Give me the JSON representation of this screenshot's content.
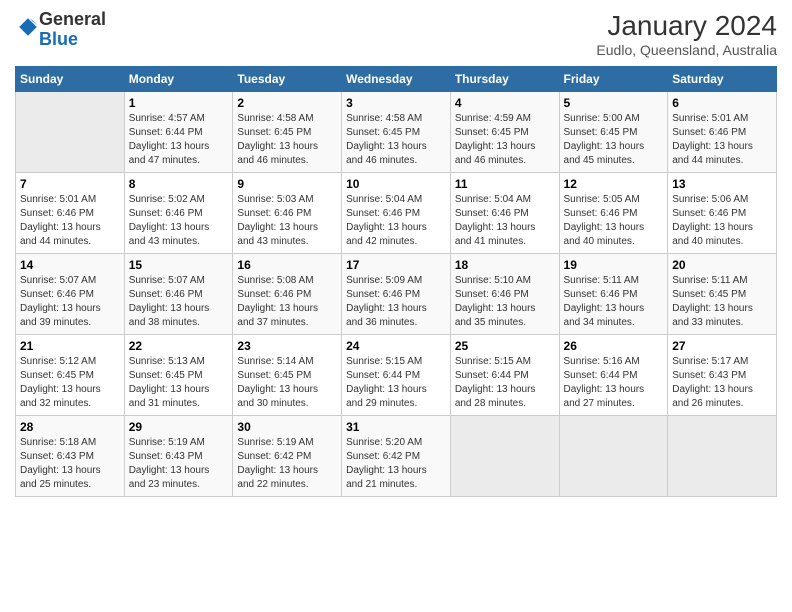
{
  "logo": {
    "general": "General",
    "blue": "Blue"
  },
  "title": "January 2024",
  "subtitle": "Eudlo, Queensland, Australia",
  "headers": [
    "Sunday",
    "Monday",
    "Tuesday",
    "Wednesday",
    "Thursday",
    "Friday",
    "Saturday"
  ],
  "weeks": [
    [
      {
        "day": "",
        "info": ""
      },
      {
        "day": "1",
        "info": "Sunrise: 4:57 AM\nSunset: 6:44 PM\nDaylight: 13 hours\nand 47 minutes."
      },
      {
        "day": "2",
        "info": "Sunrise: 4:58 AM\nSunset: 6:45 PM\nDaylight: 13 hours\nand 46 minutes."
      },
      {
        "day": "3",
        "info": "Sunrise: 4:58 AM\nSunset: 6:45 PM\nDaylight: 13 hours\nand 46 minutes."
      },
      {
        "day": "4",
        "info": "Sunrise: 4:59 AM\nSunset: 6:45 PM\nDaylight: 13 hours\nand 46 minutes."
      },
      {
        "day": "5",
        "info": "Sunrise: 5:00 AM\nSunset: 6:45 PM\nDaylight: 13 hours\nand 45 minutes."
      },
      {
        "day": "6",
        "info": "Sunrise: 5:01 AM\nSunset: 6:46 PM\nDaylight: 13 hours\nand 44 minutes."
      }
    ],
    [
      {
        "day": "7",
        "info": "Sunrise: 5:01 AM\nSunset: 6:46 PM\nDaylight: 13 hours\nand 44 minutes."
      },
      {
        "day": "8",
        "info": "Sunrise: 5:02 AM\nSunset: 6:46 PM\nDaylight: 13 hours\nand 43 minutes."
      },
      {
        "day": "9",
        "info": "Sunrise: 5:03 AM\nSunset: 6:46 PM\nDaylight: 13 hours\nand 43 minutes."
      },
      {
        "day": "10",
        "info": "Sunrise: 5:04 AM\nSunset: 6:46 PM\nDaylight: 13 hours\nand 42 minutes."
      },
      {
        "day": "11",
        "info": "Sunrise: 5:04 AM\nSunset: 6:46 PM\nDaylight: 13 hours\nand 41 minutes."
      },
      {
        "day": "12",
        "info": "Sunrise: 5:05 AM\nSunset: 6:46 PM\nDaylight: 13 hours\nand 40 minutes."
      },
      {
        "day": "13",
        "info": "Sunrise: 5:06 AM\nSunset: 6:46 PM\nDaylight: 13 hours\nand 40 minutes."
      }
    ],
    [
      {
        "day": "14",
        "info": "Sunrise: 5:07 AM\nSunset: 6:46 PM\nDaylight: 13 hours\nand 39 minutes."
      },
      {
        "day": "15",
        "info": "Sunrise: 5:07 AM\nSunset: 6:46 PM\nDaylight: 13 hours\nand 38 minutes."
      },
      {
        "day": "16",
        "info": "Sunrise: 5:08 AM\nSunset: 6:46 PM\nDaylight: 13 hours\nand 37 minutes."
      },
      {
        "day": "17",
        "info": "Sunrise: 5:09 AM\nSunset: 6:46 PM\nDaylight: 13 hours\nand 36 minutes."
      },
      {
        "day": "18",
        "info": "Sunrise: 5:10 AM\nSunset: 6:46 PM\nDaylight: 13 hours\nand 35 minutes."
      },
      {
        "day": "19",
        "info": "Sunrise: 5:11 AM\nSunset: 6:46 PM\nDaylight: 13 hours\nand 34 minutes."
      },
      {
        "day": "20",
        "info": "Sunrise: 5:11 AM\nSunset: 6:45 PM\nDaylight: 13 hours\nand 33 minutes."
      }
    ],
    [
      {
        "day": "21",
        "info": "Sunrise: 5:12 AM\nSunset: 6:45 PM\nDaylight: 13 hours\nand 32 minutes."
      },
      {
        "day": "22",
        "info": "Sunrise: 5:13 AM\nSunset: 6:45 PM\nDaylight: 13 hours\nand 31 minutes."
      },
      {
        "day": "23",
        "info": "Sunrise: 5:14 AM\nSunset: 6:45 PM\nDaylight: 13 hours\nand 30 minutes."
      },
      {
        "day": "24",
        "info": "Sunrise: 5:15 AM\nSunset: 6:44 PM\nDaylight: 13 hours\nand 29 minutes."
      },
      {
        "day": "25",
        "info": "Sunrise: 5:15 AM\nSunset: 6:44 PM\nDaylight: 13 hours\nand 28 minutes."
      },
      {
        "day": "26",
        "info": "Sunrise: 5:16 AM\nSunset: 6:44 PM\nDaylight: 13 hours\nand 27 minutes."
      },
      {
        "day": "27",
        "info": "Sunrise: 5:17 AM\nSunset: 6:43 PM\nDaylight: 13 hours\nand 26 minutes."
      }
    ],
    [
      {
        "day": "28",
        "info": "Sunrise: 5:18 AM\nSunset: 6:43 PM\nDaylight: 13 hours\nand 25 minutes."
      },
      {
        "day": "29",
        "info": "Sunrise: 5:19 AM\nSunset: 6:43 PM\nDaylight: 13 hours\nand 23 minutes."
      },
      {
        "day": "30",
        "info": "Sunrise: 5:19 AM\nSunset: 6:42 PM\nDaylight: 13 hours\nand 22 minutes."
      },
      {
        "day": "31",
        "info": "Sunrise: 5:20 AM\nSunset: 6:42 PM\nDaylight: 13 hours\nand 21 minutes."
      },
      {
        "day": "",
        "info": ""
      },
      {
        "day": "",
        "info": ""
      },
      {
        "day": "",
        "info": ""
      }
    ]
  ]
}
